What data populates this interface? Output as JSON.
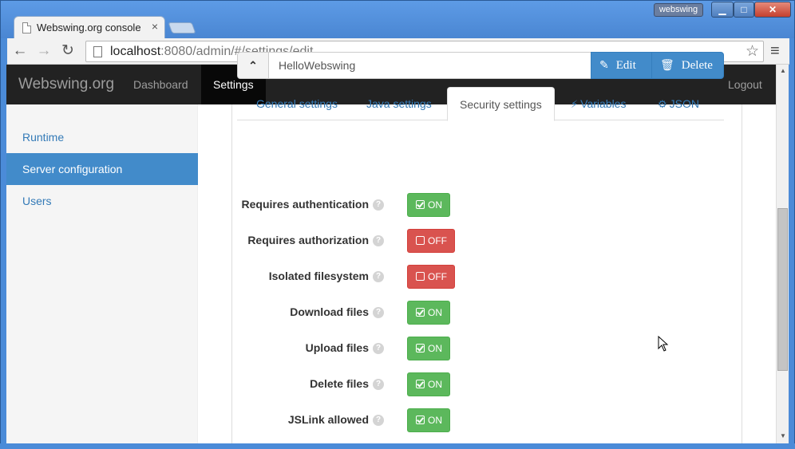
{
  "browser": {
    "tab_title": "Webswing.org console",
    "tab_close": "×",
    "user_badge": "webswing",
    "url_host": "localhost",
    "url_rest": ":8080/admin/#/settings/edit",
    "back_glyph": "←",
    "forward_glyph": "→",
    "reload_glyph": "↻",
    "star_glyph": "☆",
    "menu_glyph": "≡",
    "min_glyph": "▁",
    "max_glyph": "□",
    "close_glyph": "✕"
  },
  "navbar": {
    "brand": "Webswing.org",
    "dashboard": "Dashboard",
    "settings": "Settings",
    "logout": "Logout"
  },
  "sidebar": {
    "items": [
      {
        "label": "Runtime"
      },
      {
        "label": "Server configuration"
      },
      {
        "label": "Users"
      }
    ]
  },
  "appbar": {
    "collapse_glyph": "⌃",
    "app_name": "HelloWebswing",
    "edit_icon": "✎",
    "edit_label": "Edit",
    "delete_icon": "🗑",
    "delete_label": "Delete"
  },
  "tabs": [
    {
      "label": "General settings"
    },
    {
      "label": "Java settings"
    },
    {
      "label": "Security settings"
    },
    {
      "label": "Variables",
      "icon": "⚡"
    },
    {
      "label": "JSON",
      "icon": "⚙"
    }
  ],
  "settings": [
    {
      "label": "Requires authentication",
      "state": "ON"
    },
    {
      "label": "Requires authorization",
      "state": "OFF"
    },
    {
      "label": "Isolated filesystem",
      "state": "OFF"
    },
    {
      "label": "Download files",
      "state": "ON"
    },
    {
      "label": "Upload files",
      "state": "ON"
    },
    {
      "label": "Delete files",
      "state": "ON"
    },
    {
      "label": "JSLink allowed",
      "state": "ON"
    }
  ],
  "help_glyph": "?",
  "colors": {
    "on": "#5cb85c",
    "off": "#d9534f",
    "primary": "#428bca",
    "navbar": "#222222"
  }
}
